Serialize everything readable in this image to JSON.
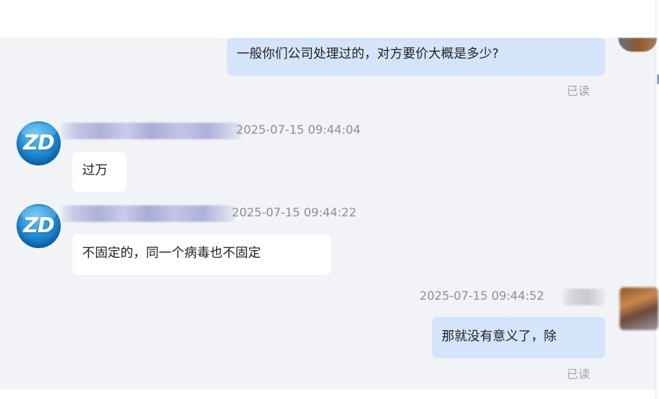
{
  "conversation": {
    "messages": [
      {
        "id": "m1",
        "direction": "outgoing",
        "text": "一般你们公司处理过的，对方要价大概是多少?",
        "status": "已读"
      },
      {
        "id": "m2",
        "direction": "incoming",
        "avatar_text": "ZD",
        "timestamp": "2025-07-15 09:44:04",
        "text": "过万"
      },
      {
        "id": "m3",
        "direction": "incoming",
        "avatar_text": "ZD",
        "timestamp": "2025-07-15 09:44:22",
        "text": "不固定的，同一个病毒也不固定"
      },
      {
        "id": "m4",
        "direction": "outgoing",
        "timestamp": "2025-07-15 09:44:52",
        "text": "那就没有意义了，除",
        "status": "已读"
      }
    ]
  },
  "colors": {
    "chat_background": "#f2f3f7",
    "outgoing_bubble": "#d4e4fa",
    "incoming_bubble": "#ffffff",
    "read_status": "#a3a6ad",
    "timestamp": "#8c8f95",
    "zd_avatar": "#1e8fd9"
  },
  "icons": {
    "support_avatar": "zd-logo-avatar",
    "user_avatar": "user-photo-avatar"
  }
}
